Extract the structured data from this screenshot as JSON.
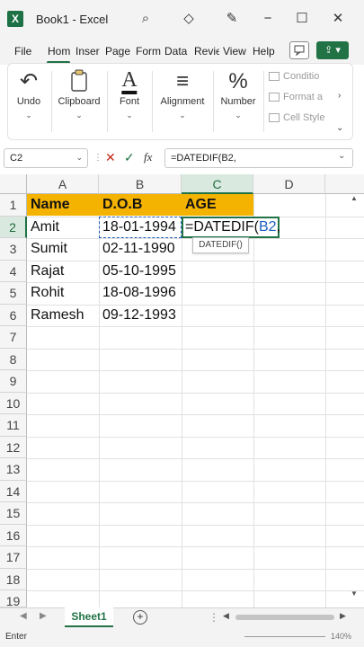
{
  "window": {
    "title": "Book1  -  Excel",
    "app_icon": "X",
    "controls": [
      "search-icon",
      "diamond-icon",
      "pen-icon",
      "minimize-icon",
      "maximize-icon",
      "close-icon"
    ]
  },
  "ribbon_tabs": [
    "File",
    "Hom",
    "Inser",
    "Page",
    "Form",
    "Data",
    "Revie",
    "View",
    "Help"
  ],
  "ribbon": {
    "groups": [
      {
        "label": "Undo",
        "icon": "undo-icon",
        "glyph": "↶"
      },
      {
        "label": "Clipboard",
        "icon": "clipboard-icon",
        "glyph": "📋"
      },
      {
        "label": "Font",
        "icon": "font-icon",
        "glyph": "A"
      },
      {
        "label": "Alignment",
        "icon": "alignment-icon",
        "glyph": "≡"
      },
      {
        "label": "Number",
        "icon": "percent-icon",
        "glyph": "%"
      }
    ],
    "styles_items": [
      "Conditio",
      "Format a",
      "Cell Style"
    ]
  },
  "formula_bar": {
    "name_box": "C2",
    "fx": "fx",
    "formula": "=DATEDIF(B2,"
  },
  "grid": {
    "columns": [
      "A",
      "B",
      "C",
      "D"
    ],
    "rows": [
      "1",
      "2",
      "3",
      "4",
      "5",
      "6",
      "7",
      "8",
      "9",
      "10",
      "11",
      "12",
      "13",
      "14",
      "15",
      "16",
      "17",
      "18",
      "19"
    ],
    "header_row": [
      "Name",
      "D.O.B",
      "AGE"
    ],
    "data": [
      [
        "Amit",
        "18-01-1994"
      ],
      [
        "Sumit",
        "02-11-1990"
      ],
      [
        "Rajat",
        "05-10-1995"
      ],
      [
        "Rohit",
        "18-08-1996"
      ],
      [
        "Ramesh",
        "09-12-1993"
      ]
    ],
    "active_cell": {
      "prefix": "=DATEDIF(",
      "ref": "B2",
      "suffix": ","
    },
    "tooltip": "DATEDIF()"
  },
  "sheets": [
    "Sheet1"
  ],
  "status": {
    "mode": "Enter",
    "zoom": "140%"
  },
  "colors": {
    "accent": "#217346",
    "header_fill": "#f5b301",
    "ref_blue": "#1f5fbf"
  }
}
